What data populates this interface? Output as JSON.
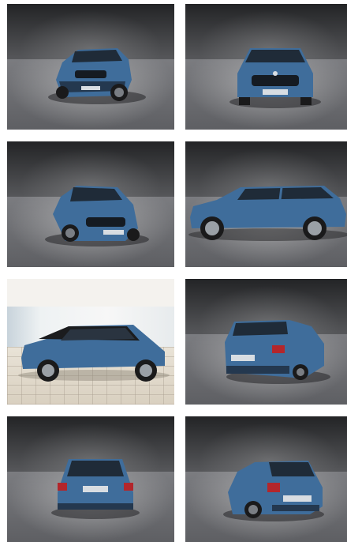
{
  "gallery": {
    "photos": [
      {
        "view": "front-left-three-quarter"
      },
      {
        "view": "front"
      },
      {
        "view": "front-left-three-quarter-low"
      },
      {
        "view": "side-left"
      },
      {
        "view": "side-showroom"
      },
      {
        "view": "rear-right-three-quarter"
      },
      {
        "view": "rear"
      },
      {
        "view": "rear-left-three-quarter"
      }
    ]
  },
  "colors": {
    "car_body": "#3f6d9b",
    "car_dark": "#24384f",
    "background": "#ffffff"
  }
}
